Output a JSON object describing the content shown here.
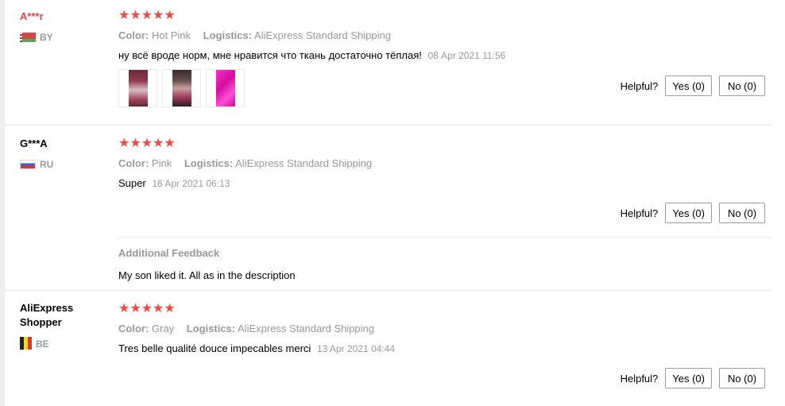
{
  "reviews": [
    {
      "user": "A***r",
      "country": "BY",
      "stars": "★★★★★",
      "color_label": "Color:",
      "color_value": "Hot Pink",
      "logistics_label": "Logistics:",
      "logistics_value": "AliExpress Standard Shipping",
      "text": "ну всё вроде норм, мне нравится что ткань достаточно тёплая!",
      "date": "08 Apr 2021 11:56",
      "helpful_label": "Helpful?",
      "yes_label": "Yes (0)",
      "no_label": "No (0)"
    },
    {
      "user": "G***A",
      "country": "RU",
      "stars": "★★★★★",
      "color_label": "Color:",
      "color_value": "Pink",
      "logistics_label": "Logistics:",
      "logistics_value": "AliExpress Standard Shipping",
      "text": "Super",
      "date": "16 Apr 2021 06:13",
      "helpful_label": "Helpful?",
      "yes_label": "Yes (0)",
      "no_label": "No (0)",
      "additional_title": "Additional Feedback",
      "additional_text": "My son liked it. All as in the description"
    },
    {
      "user": "AliExpress Shopper",
      "country": "BE",
      "stars": "★★★★★",
      "color_label": "Color:",
      "color_value": "Gray",
      "logistics_label": "Logistics:",
      "logistics_value": "AliExpress Standard Shipping",
      "text": "Tres belle qualité douce impecables merci",
      "date": "13 Apr 2021 04:44",
      "helpful_label": "Helpful?",
      "yes_label": "Yes (0)",
      "no_label": "No (0)"
    }
  ],
  "colors": {
    "star": "#f04a44",
    "username_highlight": "#e64545",
    "muted": "#999999"
  },
  "icons": [
    "flag-by-icon",
    "flag-ru-icon",
    "flag-be-icon",
    "star-icon"
  ]
}
